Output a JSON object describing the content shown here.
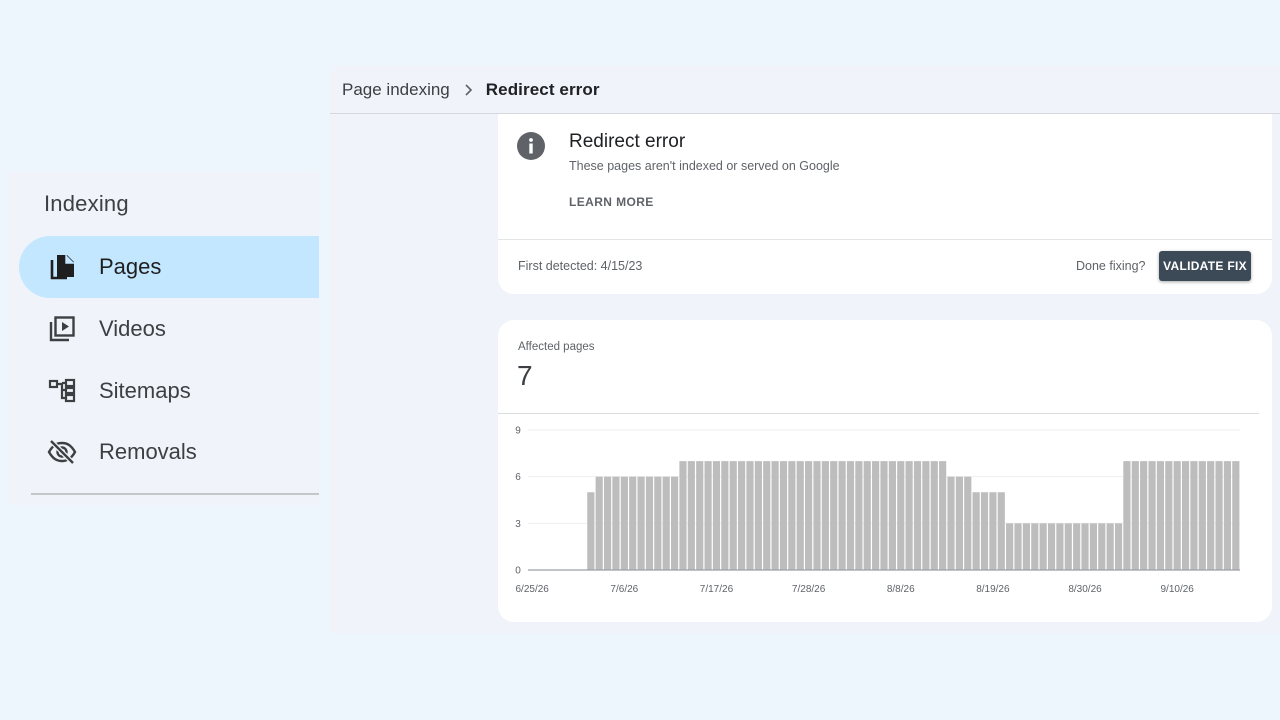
{
  "nav": {
    "heading": "Indexing",
    "items": [
      {
        "label": "Pages",
        "icon": "file-copy-icon",
        "active": true
      },
      {
        "label": "Videos",
        "icon": "video-library-icon",
        "active": false
      },
      {
        "label": "Sitemaps",
        "icon": "sitemap-icon",
        "active": false
      },
      {
        "label": "Removals",
        "icon": "visibility-off-icon",
        "active": false
      }
    ]
  },
  "breadcrumb": {
    "parent": "Page indexing",
    "current": "Redirect error"
  },
  "issue": {
    "title": "Redirect error",
    "subtitle": "These pages aren't indexed or served on Google",
    "learn_more": "LEARN MORE",
    "first_detected": "First detected: 4/15/23",
    "done_fixing": "Done fixing?",
    "validate_label": "VALIDATE FIX"
  },
  "affected": {
    "label": "Affected pages",
    "value": "7"
  },
  "colors": {
    "active_nav_bg": "#c2e7ff",
    "bar": "#bdbdbd",
    "button_bg": "#3c4a57"
  },
  "chart_data": {
    "type": "bar",
    "ylim": [
      0,
      9
    ],
    "y_ticks": [
      0,
      3,
      6,
      9
    ],
    "x_tick_labels": [
      "6/25/26",
      "7/6/26",
      "7/17/26",
      "7/28/26",
      "8/8/26",
      "8/19/26",
      "8/30/26",
      "9/10/26"
    ],
    "x_tick_day_index": [
      0,
      11,
      22,
      33,
      44,
      55,
      66,
      77
    ],
    "grid": true,
    "values": [
      0,
      0,
      0,
      0,
      0,
      0,
      0,
      5,
      6,
      6,
      6,
      6,
      6,
      6,
      6,
      6,
      6,
      6,
      7,
      7,
      7,
      7,
      7,
      7,
      7,
      7,
      7,
      7,
      7,
      7,
      7,
      7,
      7,
      7,
      7,
      7,
      7,
      7,
      7,
      7,
      7,
      7,
      7,
      7,
      7,
      7,
      7,
      7,
      7,
      7,
      6,
      6,
      6,
      5,
      5,
      5,
      5,
      3,
      3,
      3,
      3,
      3,
      3,
      3,
      3,
      3,
      3,
      3,
      3,
      3,
      3,
      7,
      7,
      7,
      7,
      7,
      7,
      7,
      7,
      7,
      7,
      7,
      7,
      7,
      7
    ]
  }
}
